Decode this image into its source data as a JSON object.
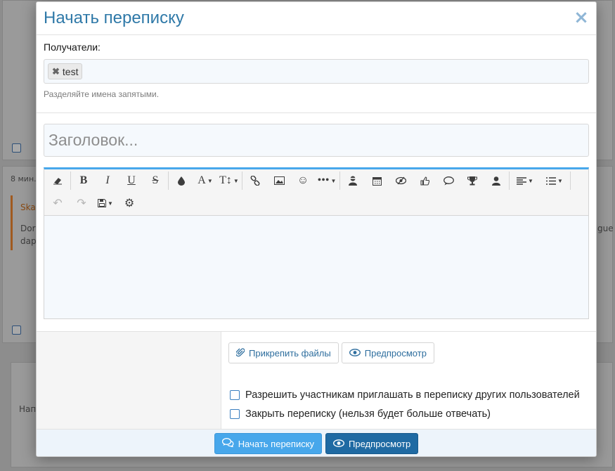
{
  "background": {
    "time_label": "8 мин.",
    "author_fragment": "Skai",
    "text_line1": "Dor",
    "text_line2": "dap",
    "right_fragment": "gue i",
    "editor_placeholder_fragment": "Нап"
  },
  "modal": {
    "title": "Начать переписку",
    "close_icon": "close-icon",
    "recipients": {
      "label": "Получатели:",
      "tokens": [
        "test"
      ],
      "hint": "Разделяйте имена запятыми."
    },
    "title_field": {
      "placeholder": "Заголовок..."
    },
    "toolbar": {
      "row1": [
        "eraser-icon",
        "bold-icon",
        "italic-icon",
        "underline-icon",
        "strike-icon",
        "color-icon",
        "font-size-icon",
        "text-style-icon",
        "link-icon",
        "image-icon",
        "smile-icon",
        "more-icon",
        "spoiler-icon",
        "calendar-icon",
        "hide-icon",
        "like-icon",
        "quote-icon",
        "trophy-icon",
        "user-icon",
        "align-icon",
        "list-icon",
        "undo-icon"
      ],
      "row2": [
        "redo-icon",
        "save-draft-icon",
        "settings-icon"
      ]
    },
    "attach_label": "Прикрепить файлы",
    "preview_label": "Предпросмотр",
    "options": [
      {
        "label": "Разрешить участникам приглашать в переписку других пользователей",
        "checked": false
      },
      {
        "label": "Закрыть переписку (нельзя будет больше отвечать)",
        "checked": false
      }
    ],
    "footer": {
      "submit_label": "Начать переписку",
      "preview_label": "Предпросмотр"
    }
  },
  "colors": {
    "accent": "#47a7eb",
    "title": "#2f79a8",
    "secondary_button": "#1f6aa3"
  }
}
